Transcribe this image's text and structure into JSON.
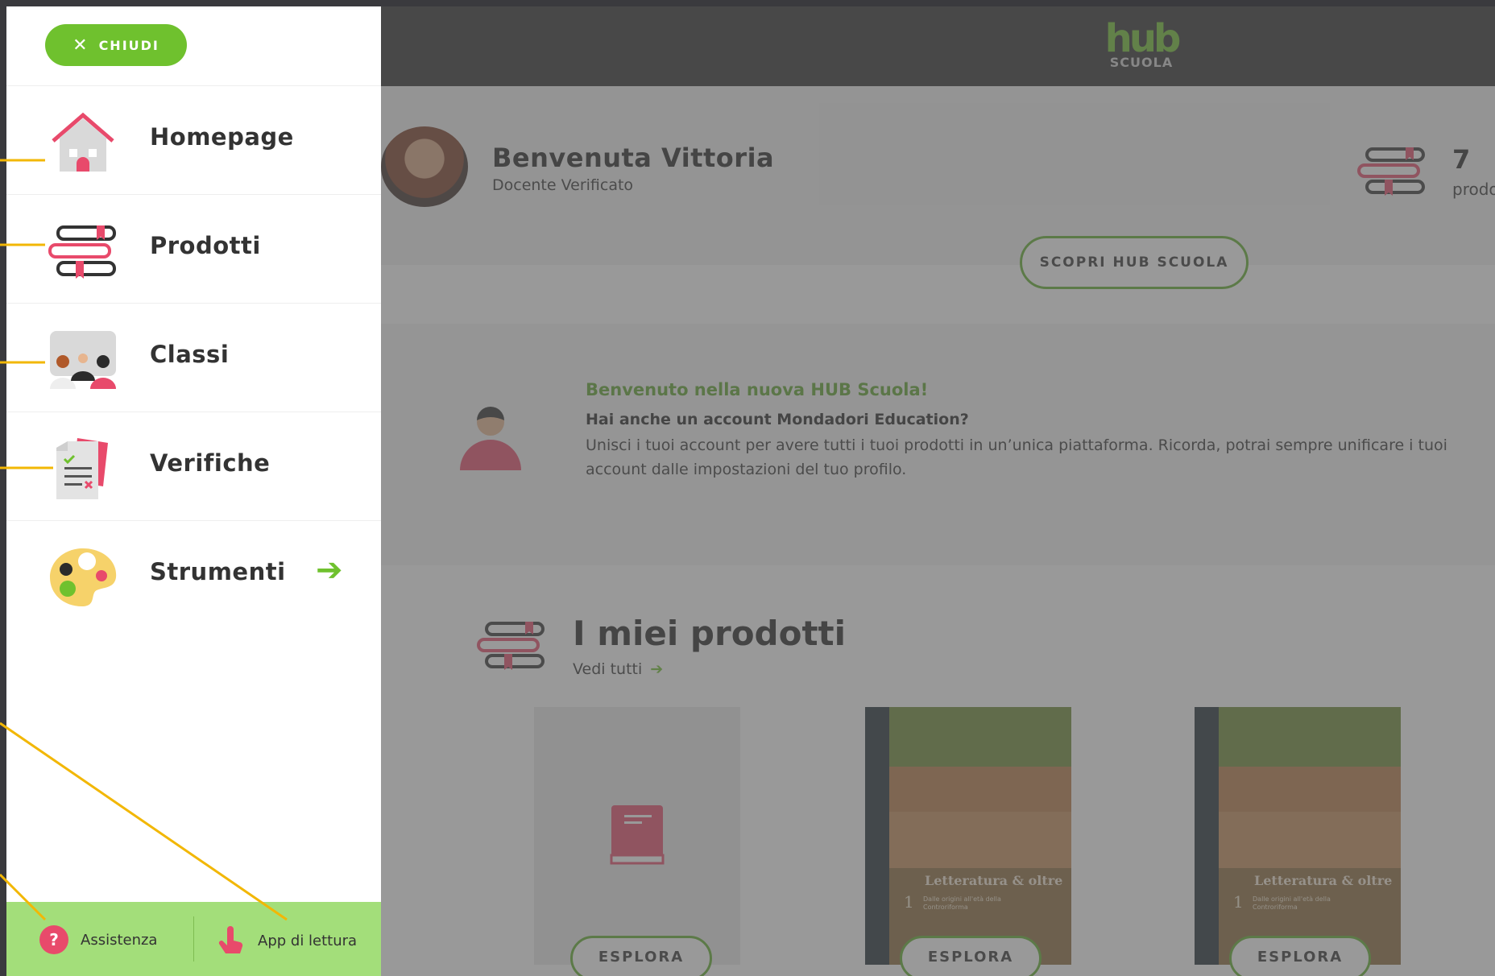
{
  "colors": {
    "accent_green": "#6fc12e",
    "callout_yellow": "#f2b705",
    "pink": "#e84a6b"
  },
  "brand": {
    "logo": "hub",
    "sub": "SCUOLA"
  },
  "drawer": {
    "close_label": "CHIUDI",
    "items": [
      {
        "label": "Homepage",
        "icon": "house-icon"
      },
      {
        "label": "Prodotti",
        "icon": "books-icon"
      },
      {
        "label": "Classi",
        "icon": "classroom-icon"
      },
      {
        "label": "Verifiche",
        "icon": "test-sheet-icon"
      },
      {
        "label": "Strumenti",
        "icon": "palette-icon"
      }
    ],
    "footer": {
      "help_label": "Assistenza",
      "reader_label": "App di lettura"
    }
  },
  "profile": {
    "greeting": "Benvenuta Vittoria",
    "role": "Docente Verificato",
    "product_count": "7",
    "product_count_label": "prodotti",
    "discover_label": "SCOPRI HUB SCUOLA"
  },
  "notice": {
    "title": "Benvenuto nella nuova HUB Scuola!",
    "question": "Hai anche un account Mondadori Education?",
    "text": "Unisci i tuoi account per avere tutti i tuoi prodotti in un’unica piattaforma. Ricorda, potrai sempre unificare i tuoi account dalle impostazioni del tuo profilo."
  },
  "products": {
    "title": "I miei prodotti",
    "see_all": "Vedi tutti",
    "cards": [
      {
        "type": "empty",
        "button": "ESPLORA"
      },
      {
        "type": "book",
        "title": "Letteratura & oltre",
        "volume": "1",
        "subtitle": "Dalle origini all'età della Controriforma",
        "button": "ESPLORA"
      },
      {
        "type": "book",
        "title": "Letteratura & oltre",
        "volume": "1",
        "subtitle": "Dalle origini all'età della Controriforma",
        "button": "ESPLORA"
      }
    ]
  }
}
